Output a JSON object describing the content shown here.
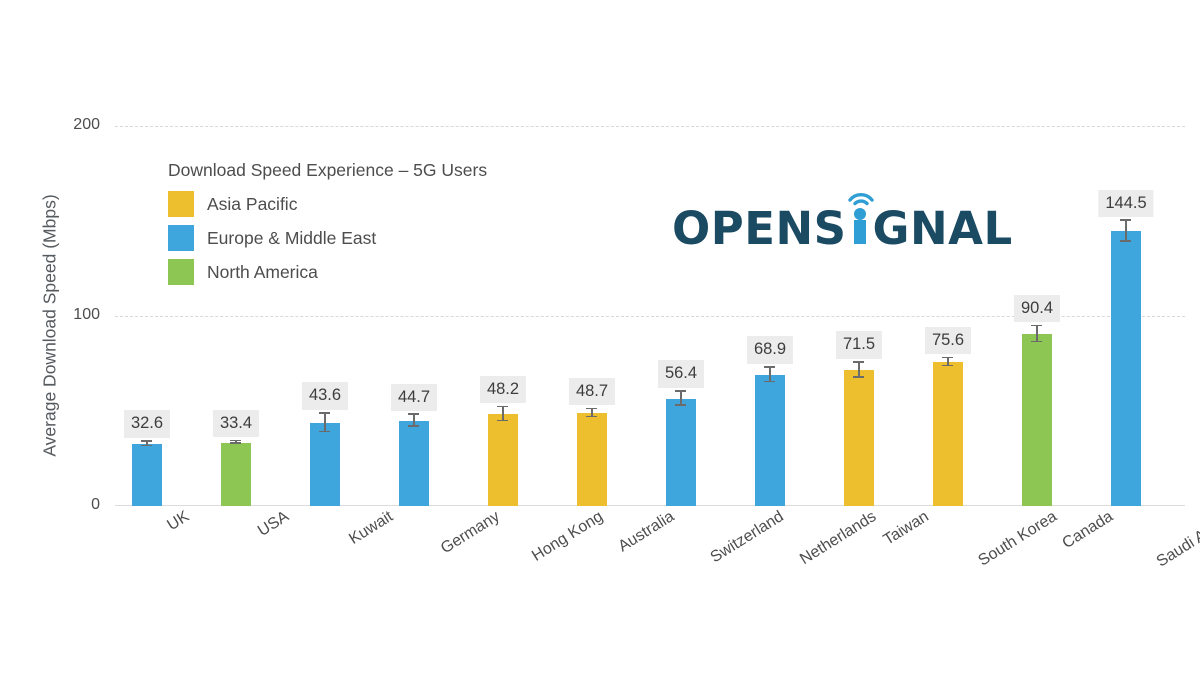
{
  "chart_data": {
    "type": "bar",
    "title": "",
    "xlabel": "",
    "ylabel": "Average Download Speed (Mbps)",
    "ylim": [
      0,
      200
    ],
    "yticks": [
      "0",
      "100",
      "200"
    ],
    "grid": "horizontal-dashed",
    "legend_position": "inside-top-left",
    "legend_title": "Download Speed Experience – 5G Users",
    "categories": [
      "UK",
      "USA",
      "Kuwait",
      "Germany",
      "Hong Kong",
      "Australia",
      "Switzerland",
      "Netherlands",
      "Taiwan",
      "South Korea",
      "Canada",
      "Saudi Arabia"
    ],
    "values": [
      32.6,
      33.4,
      43.6,
      44.7,
      48.2,
      48.7,
      56.4,
      68.9,
      71.5,
      75.6,
      90.4,
      144.5
    ],
    "labels": [
      "32.6",
      "33.4",
      "43.6",
      "44.7",
      "48.2",
      "48.7",
      "56.4",
      "68.9",
      "71.5",
      "75.6",
      "90.4",
      "144.5"
    ],
    "groups": [
      "Europe & Middle East",
      "North America",
      "Europe & Middle East",
      "Europe & Middle East",
      "Asia Pacific",
      "Asia Pacific",
      "Europe & Middle East",
      "Europe & Middle East",
      "Asia Pacific",
      "Asia Pacific",
      "North America",
      "Europe & Middle East"
    ],
    "error_high": [
      33.9,
      34.1,
      48.6,
      47.9,
      52.0,
      50.9,
      60.2,
      72.9,
      75.5,
      77.7,
      94.6,
      150.0
    ],
    "error_low": [
      31.4,
      32.8,
      38.9,
      41.8,
      44.6,
      46.7,
      52.8,
      65.1,
      67.6,
      73.6,
      86.2,
      139.0
    ],
    "series": [
      {
        "name": "Asia Pacific",
        "color": "#EDBF2E"
      },
      {
        "name": "Europe & Middle East",
        "color": "#3EA6DC"
      },
      {
        "name": "North America",
        "color": "#8DC653"
      }
    ]
  },
  "legend": {
    "title": "Download Speed Experience – 5G Users",
    "items": [
      {
        "label": "Asia Pacific",
        "color": "#EDBF2E"
      },
      {
        "label": "Europe & Middle East",
        "color": "#3EA6DC"
      },
      {
        "label": "North America",
        "color": "#8DC653"
      }
    ]
  },
  "logo": {
    "prefix": "OPENS",
    "suffix": "GNAL",
    "letter": "i",
    "dark_color": "#1B4A63",
    "accent_color": "#2E9ED4"
  },
  "colors": {
    "asia_pacific": "#EDBF2E",
    "europe_middle_east": "#3EA6DC",
    "north_america": "#8DC653",
    "label_background": "#ECECEC",
    "gridline": "#D8D8D8",
    "text": "#4D4D4D",
    "background": "#FFFFFF"
  }
}
